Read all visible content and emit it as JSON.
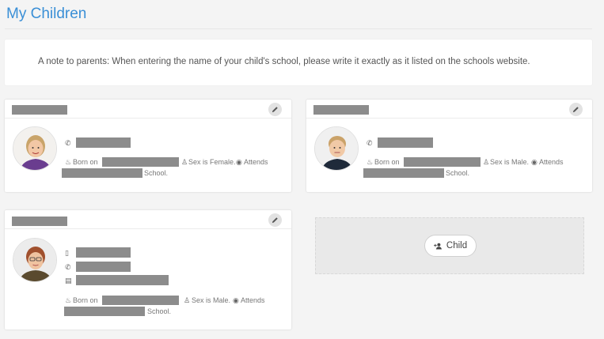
{
  "page": {
    "title": "My Children"
  },
  "note": {
    "text": "A note to parents: When entering the name of your child's school, please write it exactly as it listed on the schools website."
  },
  "children": [
    {
      "born_label": "Born on",
      "sex_text": "Sex is Female.",
      "attends_label": "Attends",
      "school_suffix": "School."
    },
    {
      "born_label": "Born on",
      "sex_text": "Sex is Male.",
      "attends_label": "Attends",
      "school_suffix": "School."
    },
    {
      "born_label": "Born on",
      "sex_text": "Sex is Male.",
      "attends_label": "Attends",
      "school_suffix": "School."
    }
  ],
  "add_child": {
    "label": "Child",
    "icon": "add-person-icon"
  },
  "icons": {
    "edit": "pencil-icon",
    "phone": "phone-icon",
    "mobile": "mobile-icon",
    "calendar": "calendar-icon",
    "cake": "cake-icon",
    "person": "person-icon",
    "eye": "eye-icon"
  },
  "colors": {
    "title": "#3a8fd6",
    "redaction": "#8c8c8c",
    "page_bg": "#f4f4f4"
  }
}
